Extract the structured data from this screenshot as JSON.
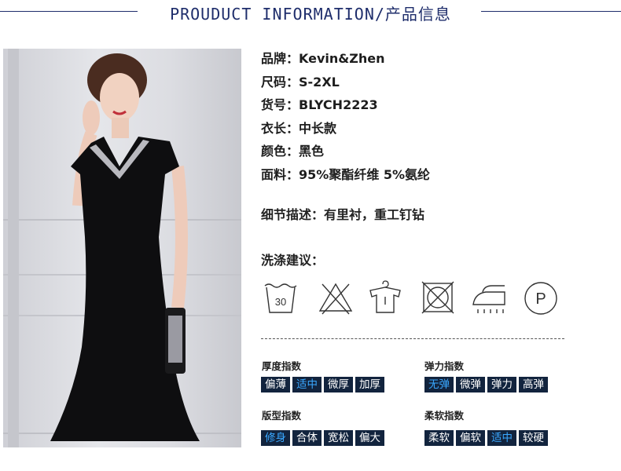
{
  "header": {
    "title": "PROUDUCT INFORMATION/产品信息"
  },
  "specs": [
    {
      "key": "品牌：",
      "value": "Kevin&Zhen"
    },
    {
      "key": "尺码：",
      "value": "S-2XL"
    },
    {
      "key": "货号：",
      "value": "BLYCH2223"
    },
    {
      "key": "衣长：",
      "value": "中长款"
    },
    {
      "key": "颜色：",
      "value": "黑色"
    },
    {
      "key": "面料：",
      "value": "95%聚酯纤维 5%氨纶"
    }
  ],
  "detail": {
    "label": "细节描述：",
    "value": "有里衬，重工钉钻"
  },
  "care": {
    "title": "洗涤建议：",
    "wash_temperature": "30",
    "icons": [
      "wash-30-icon",
      "no-bleach-icon",
      "hang-dry-icon",
      "no-tumble-dry-icon",
      "iron-icon",
      "professional-dry-clean-p-icon"
    ],
    "dry_clean_letter": "P"
  },
  "indices": {
    "thickness": {
      "label": "厚度指数",
      "options": [
        "偏薄",
        "适中",
        "微厚",
        "加厚"
      ],
      "selected": 1
    },
    "elasticity": {
      "label": "弹力指数",
      "options": [
        "无弹",
        "微弹",
        "弹力",
        "高弹"
      ],
      "selected": 0
    },
    "fit": {
      "label": "版型指数",
      "options": [
        "修身",
        "合体",
        "宽松",
        "偏大"
      ],
      "selected": 0
    },
    "softness": {
      "label": "柔软指数",
      "options": [
        "柔软",
        "偏软",
        "适中",
        "较硬"
      ],
      "selected": 2
    }
  },
  "colors": {
    "navy": "#12243e",
    "selected_text": "#3aa8ff",
    "header": "#1e2d6b"
  }
}
